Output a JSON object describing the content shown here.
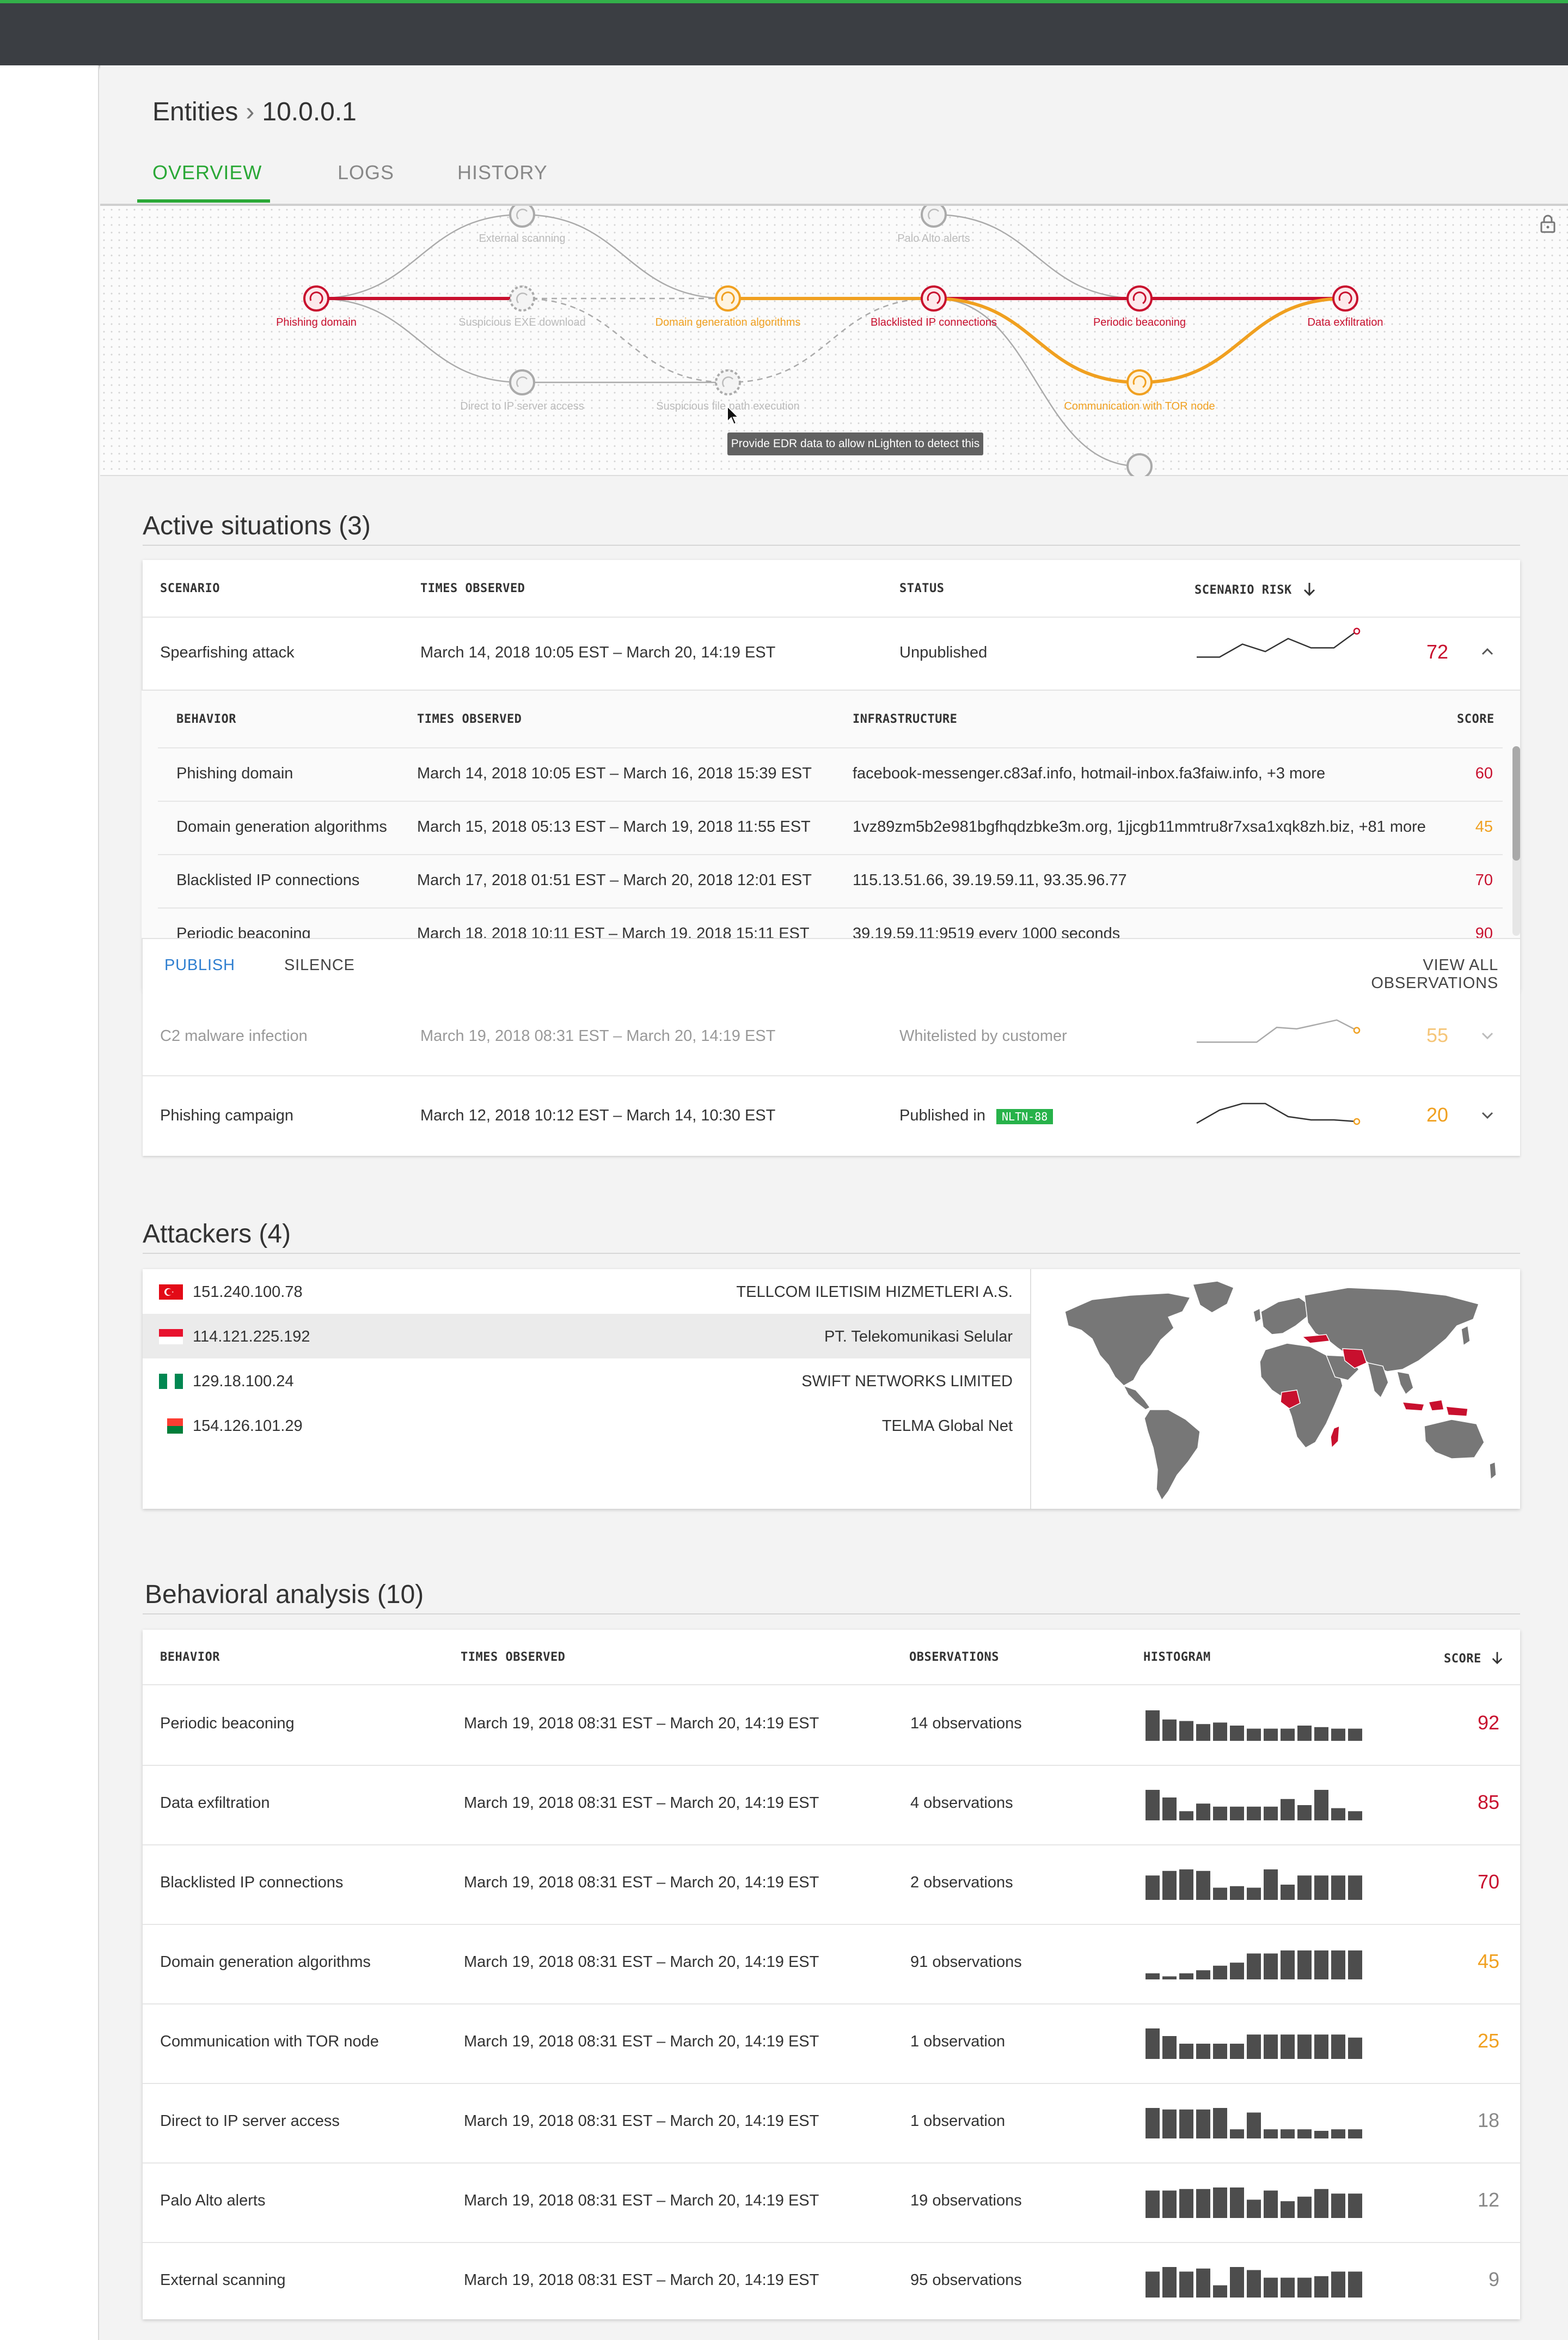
{
  "breadcrumb": {
    "root": "Entities",
    "separator": "›",
    "current": "10.0.0.1"
  },
  "tabs": [
    {
      "label": "OVERVIEW",
      "active": true
    },
    {
      "label": "LOGS",
      "active": false
    },
    {
      "label": "HISTORY",
      "active": false
    }
  ],
  "graph": {
    "tooltip": "Provide EDR data to allow nLighten to detect this",
    "nodes": [
      {
        "label": "Phishing domain",
        "state": "detected-red"
      },
      {
        "label": "External scanning",
        "state": "inactive"
      },
      {
        "label": "Suspicious EXE download",
        "state": "missing-data"
      },
      {
        "label": "Direct to IP server access",
        "state": "inactive"
      },
      {
        "label": "Domain generation algorithms",
        "state": "detected-orange"
      },
      {
        "label": "Suspicious file path execution",
        "state": "missing-data"
      },
      {
        "label": "Palo Alto alerts",
        "state": "inactive"
      },
      {
        "label": "Blacklisted IP connections",
        "state": "detected-red"
      },
      {
        "label": "Periodic beaconing",
        "state": "detected-red"
      },
      {
        "label": "Communication with TOR node",
        "state": "detected-orange"
      },
      {
        "label": "Data exfiltration",
        "state": "detected-red"
      }
    ],
    "colors": {
      "red": "#c8102e",
      "orange": "#f0a020",
      "grey": "#aaaaaa"
    }
  },
  "active_situations": {
    "title": "Active situations (3)",
    "headers": {
      "scenario": "SCENARIO",
      "times": "TIMES OBSERVED",
      "status": "STATUS",
      "risk": "SCENARIO RISK"
    },
    "rows": [
      {
        "scenario": "Spearfishing attack",
        "times": "March 14, 2018 10:05 EST – March 20, 14:19 EST",
        "status": "Unpublished",
        "score": "72",
        "trend": [
          0.2,
          0.2,
          0.55,
          0.35,
          0.7,
          0.45,
          0.45,
          0.9
        ],
        "color": "red",
        "expanded": true
      },
      {
        "scenario": "C2 malware infection",
        "times": "March 19, 2018 08:31 EST – March 20, 14:19 EST",
        "status": "Whitelisted by customer",
        "score": "55",
        "trend": [
          0.2,
          0.2,
          0.2,
          0.2,
          0.7,
          0.65,
          0.8,
          0.95,
          0.6
        ],
        "color": "orange",
        "expanded": false
      },
      {
        "scenario": "Phishing campaign",
        "times": "March 12, 2018 10:12 EST – March 14, 10:30 EST",
        "status": "Published in",
        "status_tag": "NLTN-88",
        "score": "20",
        "trend": [
          0.2,
          0.6,
          0.8,
          0.8,
          0.4,
          0.3,
          0.3,
          0.25
        ],
        "color": "orange",
        "expanded": false
      }
    ],
    "sub": {
      "headers": {
        "behavior": "BEHAVIOR",
        "times": "TIMES OBSERVED",
        "infrastructure": "INFRASTRUCTURE",
        "score": "SCORE"
      },
      "rows": [
        {
          "behavior": "Phishing domain",
          "times": "March 14, 2018 10:05 EST – March 16, 2018 15:39 EST",
          "infrastructure": "facebook-messenger.c83af.info, hotmail-inbox.fa3faiw.info, +3 more",
          "score": "60",
          "color": "red"
        },
        {
          "behavior": "Domain generation algorithms",
          "times": "March 15, 2018 05:13 EST – March 19, 2018 11:55 EST",
          "infrastructure": "1vz89zm5b2e981bgfhqdzbke3m.org, 1jjcgb11mmtru8r7xsa1xqk8zh.biz, +81 more",
          "score": "45",
          "color": "orange"
        },
        {
          "behavior": "Blacklisted IP connections",
          "times": "March 17, 2018 01:51 EST – March 20, 2018 12:01 EST",
          "infrastructure": "115.13.51.66, 39.19.59.11, 93.35.96.77",
          "score": "70",
          "color": "red"
        },
        {
          "behavior": "Periodic beaconing",
          "times": "March 18, 2018 10:11 EST – March 19, 2018 15:11 EST",
          "infrastructure": "39.19.59.11:9519 every 1000 seconds",
          "score": "90",
          "color": "red"
        }
      ]
    },
    "actions": {
      "publish": "PUBLISH",
      "silence": "SILENCE",
      "view_all": "VIEW ALL OBSERVATIONS"
    }
  },
  "attackers": {
    "title": "Attackers (4)",
    "rows": [
      {
        "ip": "151.240.100.78",
        "org": "TELLCOM ILETISIM HIZMETLERI A.S.",
        "flag": "turkey"
      },
      {
        "ip": "114.121.225.192",
        "org": "PT. Telekomunikasi Selular",
        "flag": "indonesia"
      },
      {
        "ip": "129.18.100.24",
        "org": "SWIFT NETWORKS LIMITED",
        "flag": "nigeria"
      },
      {
        "ip": "154.126.101.29",
        "org": "TELMA Global Net",
        "flag": "madagascar"
      }
    ]
  },
  "behavioral": {
    "title": "Behavioral analysis (10)",
    "headers": {
      "behavior": "BEHAVIOR",
      "times": "TIMES OBSERVED",
      "observations": "OBSERVATIONS",
      "histogram": "HISTOGRAM",
      "score": "SCORE"
    },
    "rows": [
      {
        "behavior": "Periodic beaconing",
        "times": "March 19, 2018 08:31 EST – March 20, 14:19 EST",
        "observations": "14 observations",
        "score": "92",
        "color": "red",
        "hist": [
          1,
          0.7,
          0.65,
          0.55,
          0.6,
          0.5,
          0.4,
          0.4,
          0.4,
          0.5,
          0.45,
          0.4,
          0.4
        ]
      },
      {
        "behavior": "Data exfiltration",
        "times": "March 19, 2018 08:31 EST – March 20, 14:19 EST",
        "observations": "4 observations",
        "score": "85",
        "color": "red",
        "hist": [
          1,
          0.75,
          0.3,
          0.55,
          0.45,
          0.45,
          0.45,
          0.45,
          0.7,
          0.5,
          1,
          0.4,
          0.3
        ]
      },
      {
        "behavior": "Blacklisted IP connections",
        "times": "March 19, 2018 08:31 EST – March 20, 14:19 EST",
        "observations": "2 observations",
        "score": "70",
        "color": "red",
        "hist": [
          0.8,
          0.95,
          1,
          0.95,
          0.4,
          0.45,
          0.4,
          1,
          0.5,
          0.8,
          0.8,
          0.8,
          0.8
        ]
      },
      {
        "behavior": "Domain generation algorithms",
        "times": "March 19, 2018 08:31 EST – March 20, 14:19 EST",
        "observations": "91 observations",
        "score": "45",
        "color": "orange",
        "hist": [
          0.2,
          0.1,
          0.2,
          0.3,
          0.45,
          0.55,
          0.85,
          0.85,
          0.95,
          0.95,
          0.95,
          0.95,
          0.95
        ]
      },
      {
        "behavior": "Communication with TOR node",
        "times": "March 19, 2018 08:31 EST – March 20, 14:19 EST",
        "observations": "1 observation",
        "score": "25",
        "color": "orange",
        "hist": [
          1,
          0.75,
          0.5,
          0.5,
          0.5,
          0.5,
          0.8,
          0.8,
          0.8,
          0.8,
          0.8,
          0.8,
          0.7
        ]
      },
      {
        "behavior": "Direct to IP server access",
        "times": "March 19, 2018 08:31 EST – March 20, 14:19 EST",
        "observations": "1 observation",
        "score": "18",
        "color": "grey",
        "hist": [
          1,
          0.95,
          0.95,
          0.95,
          1,
          0.3,
          0.85,
          0.3,
          0.3,
          0.3,
          0.25,
          0.3,
          0.3
        ]
      },
      {
        "behavior": "Palo Alto alerts",
        "times": "March 19, 2018 08:31 EST – March 20, 14:19 EST",
        "observations": "19 observations",
        "score": "12",
        "color": "grey",
        "hist": [
          0.9,
          0.9,
          0.95,
          0.95,
          1,
          1,
          0.6,
          0.9,
          0.55,
          0.7,
          0.95,
          0.8,
          0.8
        ]
      },
      {
        "behavior": "External scanning",
        "times": "March 19, 2018 08:31 EST – March 20, 14:19 EST",
        "observations": "95 observations",
        "score": "9",
        "color": "grey",
        "hist": [
          0.85,
          1,
          0.85,
          0.95,
          0.4,
          1,
          0.9,
          0.65,
          0.65,
          0.65,
          0.7,
          0.85,
          0.85
        ]
      }
    ]
  }
}
